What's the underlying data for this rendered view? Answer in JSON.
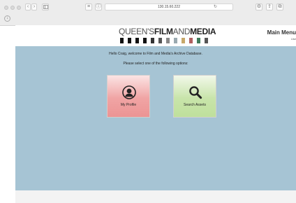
{
  "browser": {
    "url": "130.15.60.222",
    "back_icon": "chevron-left-icon",
    "forward_icon": "chevron-right-icon"
  },
  "header": {
    "logo": {
      "part1": "QUEEN'S",
      "part2": "FILM",
      "part3": "AND",
      "part4": "MEDIA"
    },
    "menu_title": "Main Menu",
    "menu_sub": "Use"
  },
  "main": {
    "greeting": "Hello Craig, welcome to Film and Media's Archive Database.",
    "instruction": "Please select one of the following options:",
    "tiles": [
      {
        "label": "My Profile",
        "icon": "user-icon",
        "color": "#f0a4a4"
      },
      {
        "label": "Search Assets",
        "icon": "search-icon",
        "color": "#c8e4aa"
      }
    ]
  },
  "colors": {
    "content_bg": "#a6c4d4",
    "filmstrip": [
      "#111111",
      "#ffffff",
      "#111111",
      "#ffffff",
      "#111111",
      "#ffffff",
      "#111111",
      "#ffffff",
      "#333333",
      "#ffffff",
      "#555555",
      "#ffffff",
      "#888888",
      "#ffffff",
      "#9aa9b0",
      "#ffffff",
      "#c7a86a",
      "#ffffff",
      "#b06060",
      "#ffffff",
      "#3f7a5a",
      "#ffffff",
      "#555555"
    ]
  }
}
